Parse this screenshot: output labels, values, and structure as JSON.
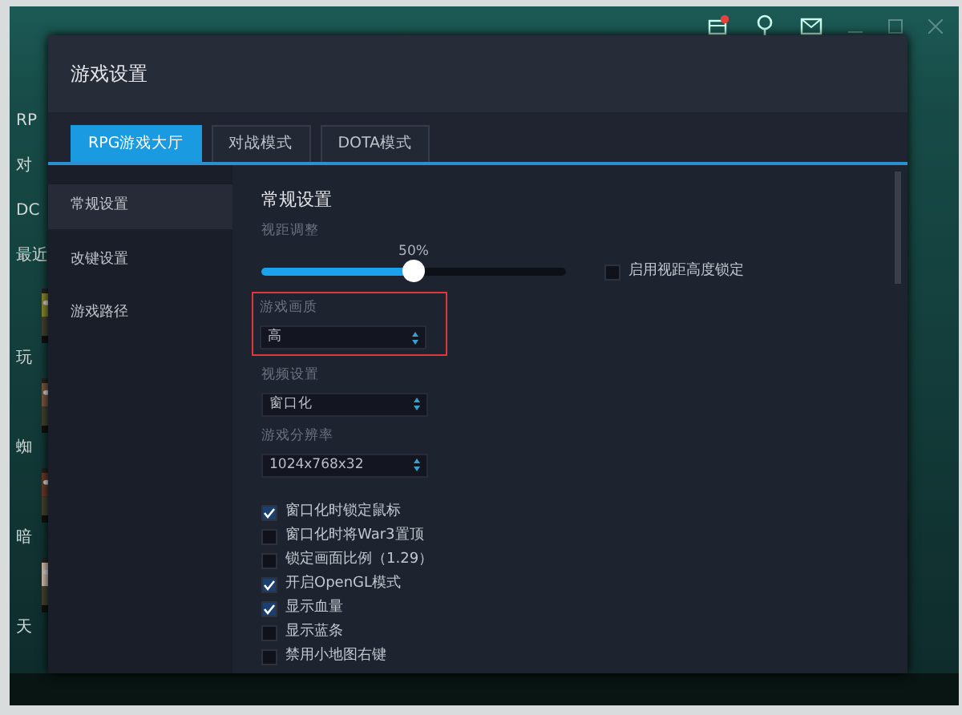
{
  "app": {
    "sidebar_fragments": [
      "RP",
      "对",
      "DC",
      "最近"
    ],
    "recent": [
      {
        "kind": "picture",
        "label": "玩"
      },
      {
        "kind": "picture",
        "label": "蜘"
      },
      {
        "kind": "picture",
        "label": "暗"
      },
      {
        "kind": "picture",
        "label": "天"
      }
    ],
    "notification_dot": true
  },
  "dialog": {
    "title": "游戏设置",
    "tabs": [
      {
        "label": "RPG游戏大厅",
        "selected": true
      },
      {
        "label": "对战模式",
        "selected": false
      },
      {
        "label": "DOTA模式",
        "selected": false
      }
    ],
    "sidebar": [
      {
        "label": "常规设置",
        "selected": true
      },
      {
        "label": "改键设置",
        "selected": false
      },
      {
        "label": "游戏路径",
        "selected": false
      }
    ],
    "section_title": "常规设置",
    "slider": {
      "label": "视距调整",
      "reading": "50%",
      "level": 0.5
    },
    "lock_option": {
      "label": "启用视距高度锁定",
      "checked": false
    },
    "selects": [
      {
        "label": "游戏画质",
        "value": "高",
        "highlighted": true
      },
      {
        "label": "视频设置",
        "value": "窗口化",
        "highlighted": false
      },
      {
        "label": "游戏分辨率",
        "value": "1024x768x32",
        "highlighted": false
      }
    ],
    "options": [
      {
        "label": "窗口化时锁定鼠标",
        "checked": true
      },
      {
        "label": "窗口化时将War3置顶",
        "checked": false
      },
      {
        "label": "锁定画面比例（1.29）",
        "checked": false
      },
      {
        "label": "开启OpenGL模式",
        "checked": true
      },
      {
        "label": "显示血量",
        "checked": true
      },
      {
        "label": "显示蓝条",
        "checked": false
      },
      {
        "label": "禁用小地图右键",
        "checked": false
      }
    ]
  }
}
